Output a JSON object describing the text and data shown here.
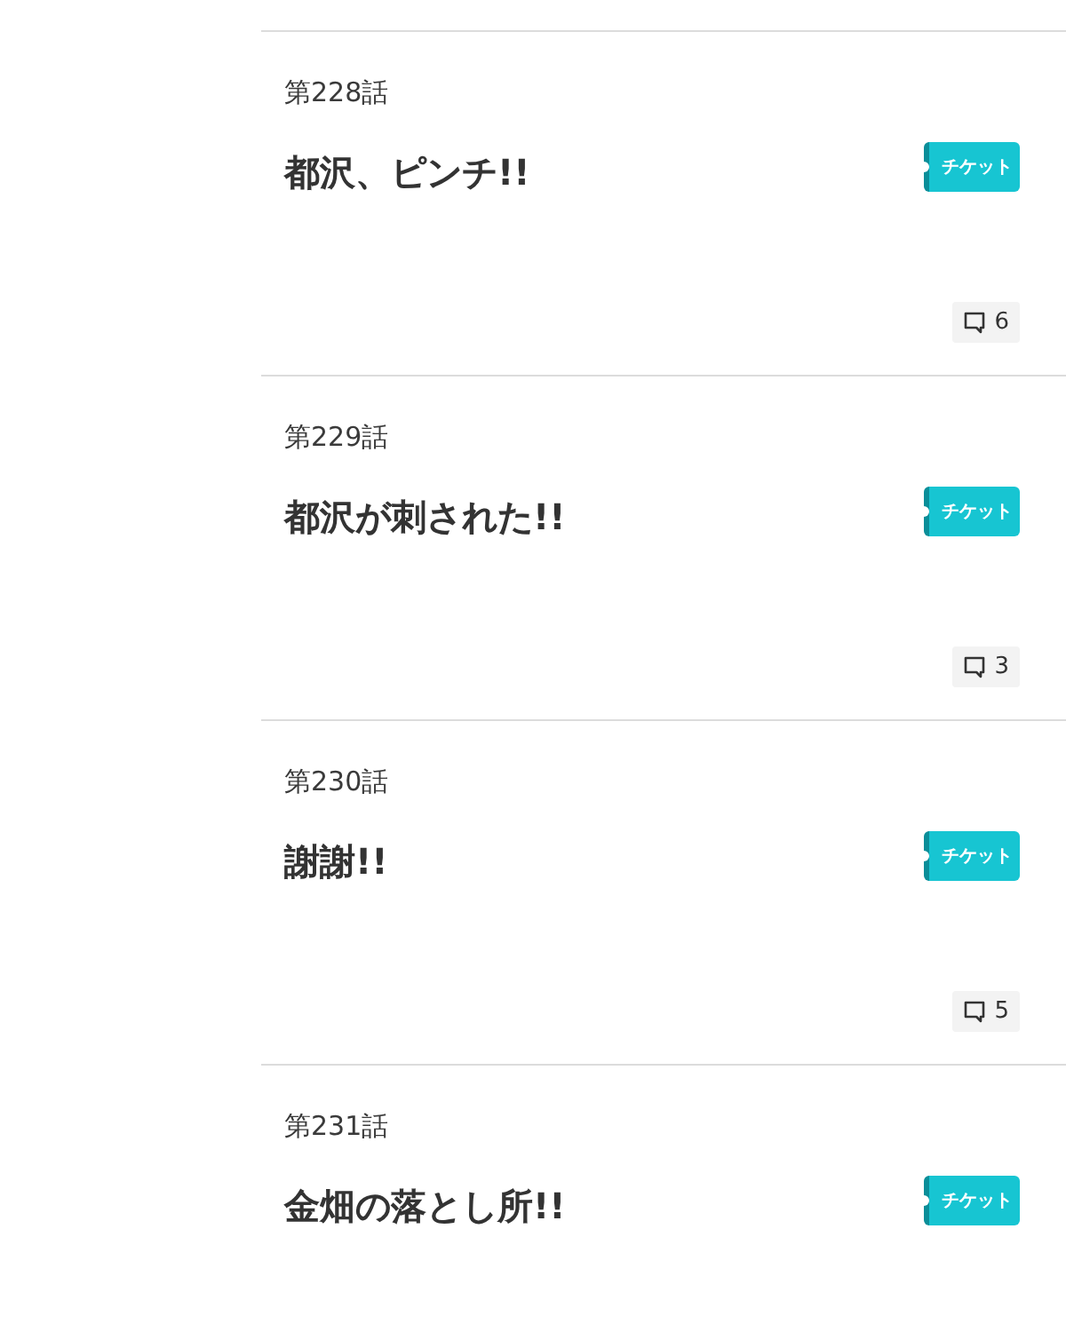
{
  "episodes": [
    {
      "number": "第228話",
      "title": "都沢、ピンチ!!",
      "ticket": "チケット",
      "comments": "6"
    },
    {
      "number": "第229話",
      "title": "都沢が刺された!!",
      "ticket": "チケット",
      "comments": "3"
    },
    {
      "number": "第230話",
      "title": "謝謝!!",
      "ticket": "チケット",
      "comments": "5"
    },
    {
      "number": "第231話",
      "title": "金畑の落とし所!!",
      "ticket": "チケット"
    }
  ]
}
